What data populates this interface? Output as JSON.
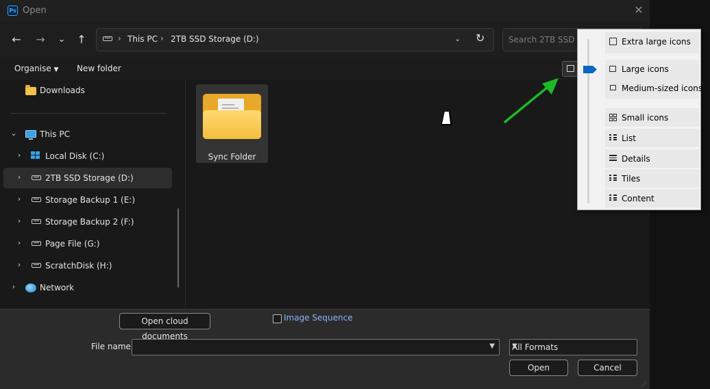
{
  "window": {
    "title": "Open",
    "app_icon": "Ps"
  },
  "nav": {
    "back_label": "←",
    "forward_label": "→",
    "recent_label": "⌄",
    "up_label": "↑"
  },
  "address": {
    "crumbs": [
      "This PC",
      "2TB SSD Storage (D:)"
    ],
    "separator": "›"
  },
  "search": {
    "placeholder": "Search 2TB SSD Sto"
  },
  "commands": {
    "organise": "Organise",
    "new_folder": "New folder"
  },
  "sidebar": {
    "items": [
      {
        "label": "Downloads",
        "icon": "folder-icon"
      },
      {
        "label": "This PC",
        "icon": "pc-icon",
        "expanded": true
      },
      {
        "label": "Local Disk (C:)",
        "icon": "windows-drive-icon"
      },
      {
        "label": "2TB SSD Storage (D:)",
        "icon": "drive-icon",
        "selected": true
      },
      {
        "label": "Storage Backup 1 (E:)",
        "icon": "drive-icon"
      },
      {
        "label": "Storage Backup 2 (F:)",
        "icon": "drive-icon"
      },
      {
        "label": "Page File (G:)",
        "icon": "drive-icon"
      },
      {
        "label": "ScratchDisk (H:)",
        "icon": "drive-icon"
      },
      {
        "label": "Network",
        "icon": "network-icon"
      }
    ]
  },
  "content": {
    "items": [
      {
        "label": "Sync Folder",
        "icon": "folder-icon"
      }
    ]
  },
  "bottom": {
    "cloud_button": "Open cloud documents",
    "image_sequence": "Image Sequence",
    "file_name_label": "File name:",
    "file_name_value": "",
    "format": "All Formats",
    "open_button": "Open",
    "cancel_button": "Cancel"
  },
  "view_menu": {
    "items": [
      "Extra large icons",
      "Large icons",
      "Medium-sized icons",
      "Small icons",
      "List",
      "Details",
      "Tiles",
      "Content"
    ],
    "selected": "Large icons"
  },
  "colors": {
    "accent": "#0a66c2",
    "arrow": "#1db924",
    "link": "#8ab4f8"
  }
}
